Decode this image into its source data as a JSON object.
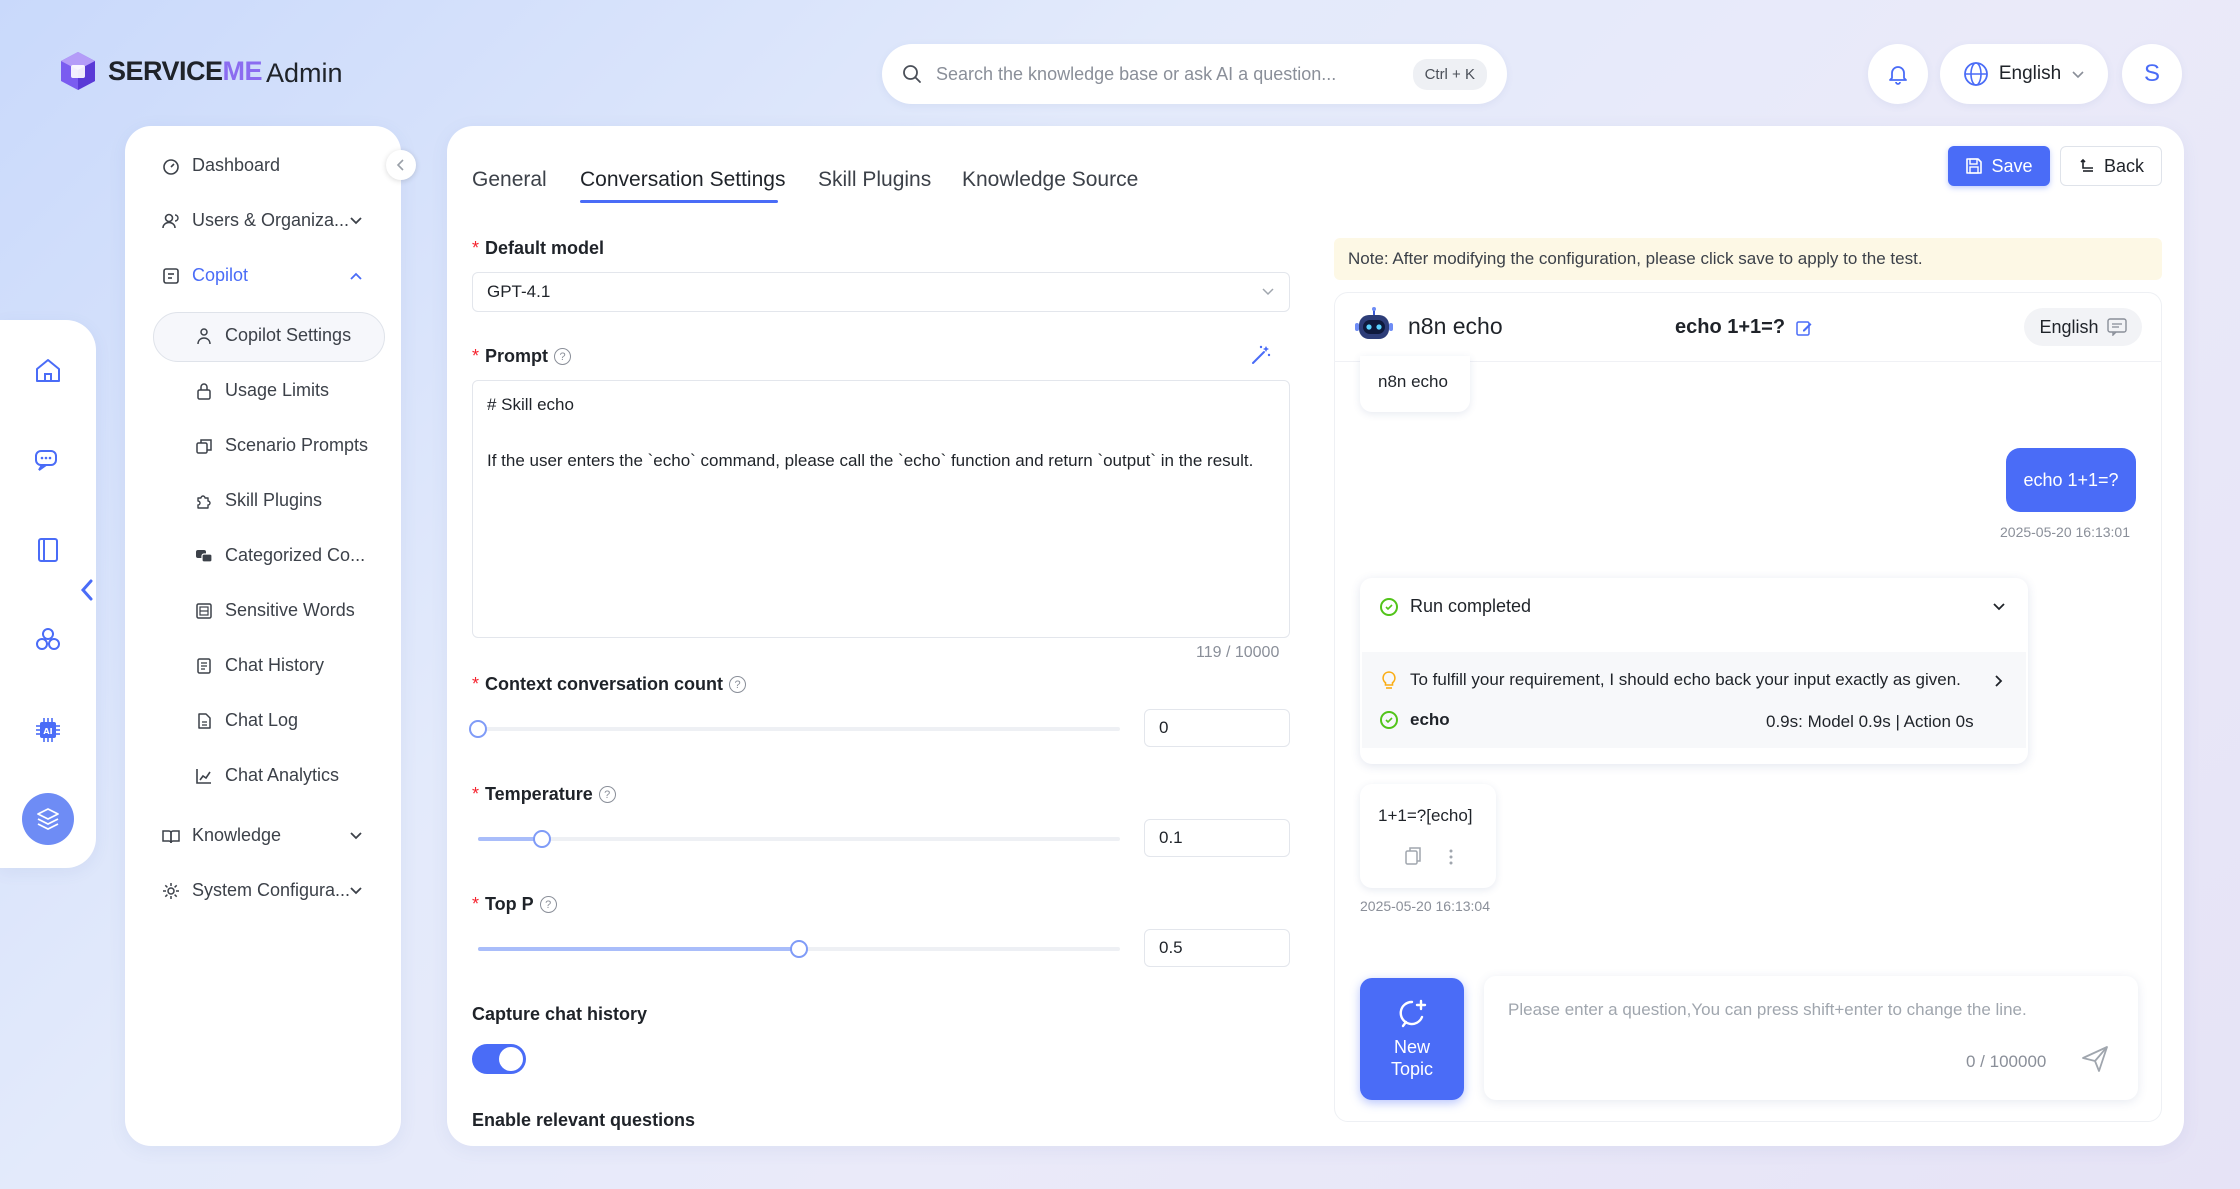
{
  "header": {
    "brand_service": "SERVICE",
    "brand_me": "ME",
    "admin_label": "Admin",
    "search_placeholder": "Search the knowledge base or ask AI a question...",
    "search_shortcut": "Ctrl + K",
    "language": "English",
    "avatar_initial": "S"
  },
  "sidebar": {
    "dashboard": "Dashboard",
    "users": "Users & Organiza...",
    "copilot": "Copilot",
    "copilot_items": [
      "Copilot Settings",
      "Usage Limits",
      "Scenario Prompts",
      "Skill Plugins",
      "Categorized Co...",
      "Sensitive Words",
      "Chat History",
      "Chat Log",
      "Chat Analytics"
    ],
    "knowledge": "Knowledge",
    "system": "System Configura..."
  },
  "tabs": [
    "General",
    "Conversation Settings",
    "Skill Plugins",
    "Knowledge Source"
  ],
  "actions": {
    "save": "Save",
    "back": "Back"
  },
  "form": {
    "default_model_label": "Default model",
    "default_model_value": "GPT-4.1",
    "prompt_label": "Prompt",
    "prompt_value": "# Skill echo\n\nIf the user enters the `echo` command, please call the `echo` function and return `output` in the result.",
    "prompt_counter": "119 / 10000",
    "context_label": "Context conversation count",
    "context_value": "0",
    "context_fraction": 0,
    "temperature_label": "Temperature",
    "temperature_value": "0.1",
    "temperature_fraction": 0.1,
    "topp_label": "Top P",
    "topp_value": "0.5",
    "topp_fraction": 0.5,
    "capture_label": "Capture chat history",
    "capture_enabled": true,
    "relevant_label": "Enable relevant questions"
  },
  "test": {
    "note": "Note: After modifying the configuration, please click save to apply to the test.",
    "bot_name": "n8n echo",
    "conversation_title": "echo 1+1=?",
    "language": "English",
    "bot_greeting": "n8n echo",
    "user_message": "echo 1+1=?",
    "user_time": "2025-05-20 16:13:01",
    "run_status": "Run completed",
    "run_thought": "To fulfill your requirement, I should echo back your input exactly as given.",
    "run_tool": "echo",
    "run_timing": "0.9s: Model 0.9s | Action 0s",
    "bot_reply": "1+1=?[echo]",
    "bot_time": "2025-05-20 16:13:04",
    "new_topic": "New Topic",
    "input_placeholder": "Please enter a question,You can press shift+enter to change the line.",
    "input_counter": "0 / 100000"
  }
}
